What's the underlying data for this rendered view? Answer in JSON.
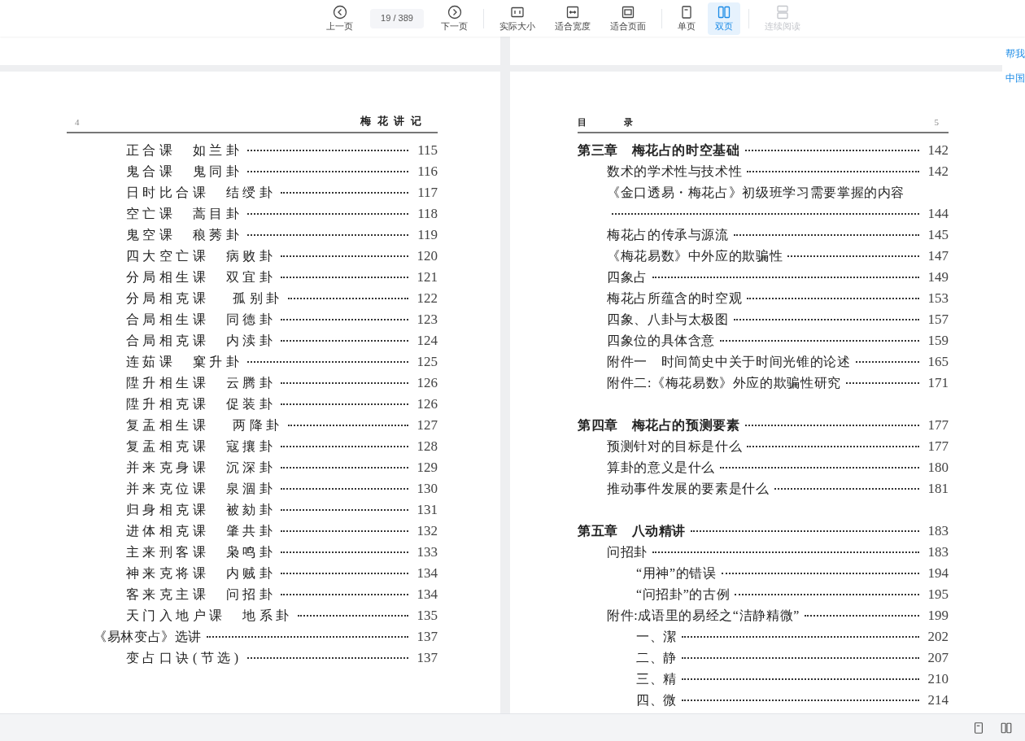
{
  "toolbar": {
    "items": [
      {
        "kind": "button",
        "label": "上一页",
        "selected": false,
        "disabled": false
      },
      {
        "kind": "page_field",
        "value": "19 / 389"
      },
      {
        "kind": "button",
        "label": "下一页",
        "selected": false,
        "disabled": false
      },
      {
        "kind": "separator"
      },
      {
        "kind": "button",
        "label": "实际大小",
        "selected": false,
        "disabled": false
      },
      {
        "kind": "button",
        "label": "适合宽度",
        "selected": false,
        "disabled": false
      },
      {
        "kind": "button",
        "label": "适合页面",
        "selected": false,
        "disabled": false
      },
      {
        "kind": "separator"
      },
      {
        "kind": "button",
        "label": "单页",
        "selected": false,
        "disabled": false
      },
      {
        "kind": "button",
        "label": "双页",
        "selected": true,
        "disabled": false
      },
      {
        "kind": "separator"
      },
      {
        "kind": "button",
        "label": "连续阅读",
        "selected": false,
        "disabled": true
      }
    ]
  },
  "left_page": {
    "page_number": "4",
    "running_title": "梅花讲记",
    "continued_entries": [
      {
        "title": "正合课　如兰卦",
        "page": "115"
      },
      {
        "title": "鬼合课　鬼同卦",
        "page": "116"
      },
      {
        "title": "日时比合课　结绶卦",
        "page": "117"
      },
      {
        "title": "空亡课　蒿目卦",
        "page": "118"
      },
      {
        "title": "鬼空课　稂莠卦",
        "page": "119"
      },
      {
        "title": "四大空亡课　病败卦",
        "page": "120"
      },
      {
        "title": "分局相生课　双宜卦",
        "page": "121"
      },
      {
        "title": "分局相克课　 孤别卦",
        "page": "122"
      },
      {
        "title": "合局相生课　同德卦",
        "page": "123"
      },
      {
        "title": "合局相克课　内渎卦",
        "page": "124"
      },
      {
        "title": "连茹课　窠升卦",
        "page": "125"
      },
      {
        "title": "陞升相生课　云腾卦",
        "page": "126"
      },
      {
        "title": "陞升相克课　促装卦",
        "page": "126"
      },
      {
        "title": "复盂相生课　 两降卦",
        "page": "127"
      },
      {
        "title": "复盂相克课　寇攘卦",
        "page": "128"
      },
      {
        "title": "并来克身课　沉深卦",
        "page": "129"
      },
      {
        "title": "并来克位课　泉涸卦",
        "page": "130"
      },
      {
        "title": "归身相克课　被劾卦",
        "page": "131"
      },
      {
        "title": "进体相克课　肇共卦",
        "page": "132"
      },
      {
        "title": "主来刑客课　枭鸣卦",
        "page": "133"
      },
      {
        "title": "神来克将课　内贼卦",
        "page": "134"
      },
      {
        "title": "客来克主课　问招卦",
        "page": "134"
      },
      {
        "title": "天门入地户课　地系卦",
        "page": "135"
      }
    ],
    "entries": [
      {
        "title": "《易林变占》选讲",
        "page": "137",
        "children": [
          {
            "title": "变占口诀(节选)",
            "page": "137"
          }
        ]
      }
    ]
  },
  "right_page": {
    "running_title": "目　录",
    "page_number": "5",
    "entries": [
      {
        "title": "第三章　梅花占的时空基础",
        "page": "142",
        "children": [
          {
            "title": "数术的学术性与技术性",
            "page": "142"
          },
          {
            "title": "《金口透易・梅花占》初级班学习需要掌握的内容",
            "page": "144"
          },
          {
            "title": "梅花占的传承与源流",
            "page": "145"
          },
          {
            "title": "《梅花易数》中外应的欺骗性",
            "page": "147"
          },
          {
            "title": "四象占",
            "page": "149"
          },
          {
            "title": "梅花占所蕴含的时空观",
            "page": "153"
          },
          {
            "title": "四象、八卦与太极图",
            "page": "157"
          },
          {
            "title": "四象位的具体含意",
            "page": "159"
          },
          {
            "title": "附件一　时间简史中关于时间光锥的论述",
            "page": "165"
          },
          {
            "title": "附件二:《梅花易数》外应的欺骗性研究",
            "page": "171"
          }
        ]
      },
      {
        "title": "第四章　梅花占的预测要素",
        "page": "177",
        "children": [
          {
            "title": "预测针对的目标是什么",
            "page": "177"
          },
          {
            "title": "算卦的意义是什么",
            "page": "180"
          },
          {
            "title": "推动事件发展的要素是什么",
            "page": "181"
          }
        ]
      },
      {
        "title": "第五章　八动精讲",
        "page": "183",
        "children": [
          {
            "title": "问招卦",
            "page": "183",
            "children": [
              {
                "title": "“用神”的错误",
                "page": "194"
              },
              {
                "title": "“问招卦”的古例",
                "page": "195"
              }
            ]
          },
          {
            "title": "附件:成语里的易经之“洁静精微”",
            "page": "199",
            "children": [
              {
                "title": "一、潔",
                "page": "202"
              },
              {
                "title": "二、静",
                "page": "207"
              },
              {
                "title": "三、精",
                "page": "210"
              },
              {
                "title": "四、微",
                "page": "214"
              }
            ]
          }
        ]
      }
    ]
  },
  "side_panel": {
    "links": [
      "帮我",
      "中国"
    ]
  },
  "status_bar": {
    "buttons": [
      {
        "selected": false
      },
      {
        "selected": false
      }
    ]
  }
}
